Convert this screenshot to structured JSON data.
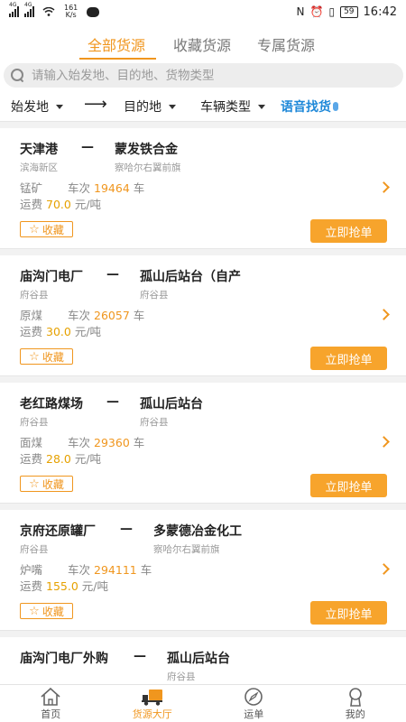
{
  "status_bar": {
    "signal1": "4G",
    "signal2": "4G",
    "speed_value": "161",
    "speed_unit": "K/s",
    "battery": "59",
    "time": "16:42",
    "icons": [
      "nfc-icon",
      "alarm-icon",
      "vibrate-icon",
      "battery-icon",
      "wifi-icon",
      "chat-icon"
    ]
  },
  "tabs": [
    {
      "label": "全部货源",
      "active": true
    },
    {
      "label": "收藏货源",
      "active": false
    },
    {
      "label": "专属货源",
      "active": false
    }
  ],
  "search": {
    "placeholder": "请输入始发地、目的地、货物类型"
  },
  "filters": {
    "origin": "始发地",
    "arrow": "⟶",
    "destination": "目的地",
    "vehicle_type": "车辆类型",
    "voice": "语音找货"
  },
  "labels": {
    "trips": "车次",
    "trips_unit": "车",
    "freight": "运费",
    "freight_unit": "元/吨",
    "favorite": "收藏",
    "grab": "立即抢单",
    "dash": "—"
  },
  "cargo": [
    {
      "origin": "天津港",
      "origin_district": "滨海新区",
      "destination": "蒙发铁合金",
      "destination_district": "察哈尔右翼前旗",
      "goods": "锰矿",
      "trips": "19464",
      "freight": "70.0"
    },
    {
      "origin": "庙沟门电厂",
      "origin_district": "府谷县",
      "destination": "孤山后站台（自产",
      "destination_district": "府谷县",
      "goods": "原煤",
      "trips": "26057",
      "freight": "30.0"
    },
    {
      "origin": "老红路煤场",
      "origin_district": "府谷县",
      "destination": "孤山后站台",
      "destination_district": "府谷县",
      "goods": "面煤",
      "trips": "29360",
      "freight": "28.0"
    },
    {
      "origin": "京府还原罐厂",
      "origin_district": "府谷县",
      "destination": "多蒙德冶金化工",
      "destination_district": "察哈尔右翼前旗",
      "goods": "炉嘴",
      "trips": "294111",
      "freight": "155.0"
    },
    {
      "origin": "庙沟门电厂外购",
      "origin_district": "",
      "destination": "孤山后站台",
      "destination_district": "府谷县",
      "goods": "",
      "trips": "",
      "freight": ""
    }
  ],
  "bottom_nav": [
    {
      "label": "首页",
      "icon": "home-icon",
      "active": false
    },
    {
      "label": "货源大厅",
      "icon": "truck-icon",
      "active": true
    },
    {
      "label": "运单",
      "icon": "compass-icon",
      "active": false
    },
    {
      "label": "我的",
      "icon": "user-icon",
      "active": false
    }
  ],
  "colors": {
    "accent": "#f0961e",
    "button": "#f7a42c",
    "voice": "#1e88d8"
  }
}
